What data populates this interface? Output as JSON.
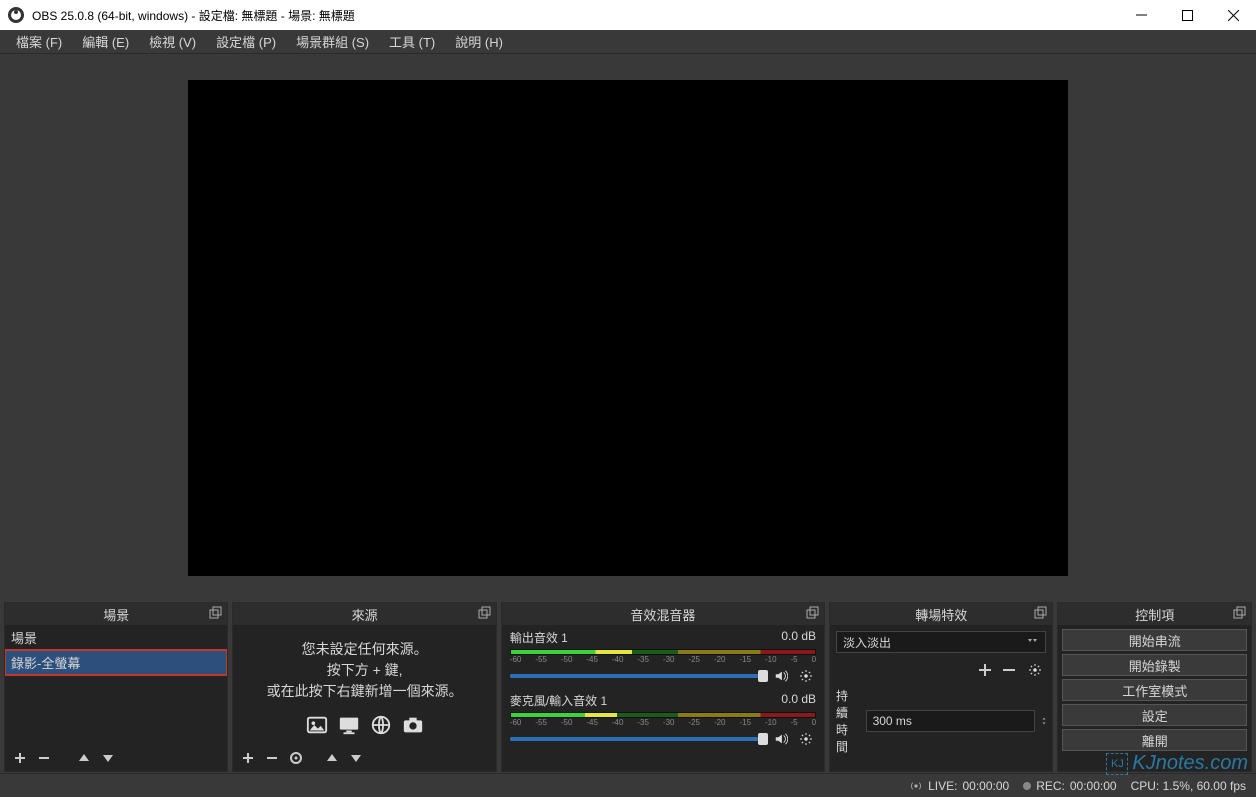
{
  "title": "OBS 25.0.8 (64-bit, windows) - 設定檔: 無標題 - 場景: 無標題",
  "menu": {
    "file": "檔案 (F)",
    "edit": "編輯 (E)",
    "view": "檢視 (V)",
    "profile": "設定檔 (P)",
    "sceneCollection": "場景群組 (S)",
    "tools": "工具 (T)",
    "help": "說明 (H)"
  },
  "panels": {
    "scenes": {
      "title": "場景",
      "items": [
        "場景",
        "錄影-全螢幕"
      ],
      "selectedIndex": 1
    },
    "sources": {
      "title": "來源",
      "empty_line1": "您未設定任何來源。",
      "empty_line2": "按下方 + 鍵,",
      "empty_line3": "或在此按下右鍵新增一個來源。"
    },
    "mixer": {
      "title": "音效混音器",
      "tracks": [
        {
          "name": "輸出音效 1",
          "db": "0.0 dB",
          "fill": 40,
          "thumb": 97
        },
        {
          "name": "麥克風/輸入音效 1",
          "db": "0.0 dB",
          "fill": 35,
          "thumb": 97
        }
      ],
      "ticks": [
        "-60",
        "-55",
        "-50",
        "-45",
        "-40",
        "-35",
        "-30",
        "-25",
        "-20",
        "-15",
        "-10",
        "-5",
        "0"
      ]
    },
    "transitions": {
      "title": "轉場特效",
      "selected": "淡入淡出",
      "duration_label": "持續時間",
      "duration_value": "300 ms"
    },
    "controls": {
      "title": "控制項",
      "buttons": [
        "開始串流",
        "開始錄製",
        "工作室模式",
        "設定",
        "離開"
      ]
    }
  },
  "status": {
    "live_label": "LIVE:",
    "live_time": "00:00:00",
    "rec_label": "REC:",
    "rec_time": "00:00:00",
    "cpu": "CPU: 1.5%, 60.00 fps"
  },
  "watermark": "KJnotes.com"
}
